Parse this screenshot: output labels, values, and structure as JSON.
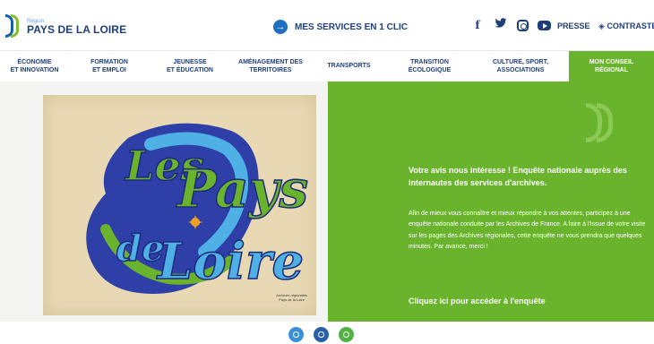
{
  "header": {
    "logo_small": "Région",
    "logo_name": "PAYS DE LA LOIRE",
    "services_label": "MES SERVICES EN 1 CLIC",
    "presse_label": "PRESSE",
    "contraste_label": "CONTRASTE",
    "contraste_icon": "◈",
    "social_icons": [
      "facebook-icon",
      "twitter-icon",
      "instagram-icon",
      "youtube-icon"
    ]
  },
  "nav": {
    "items": [
      {
        "line1": "ÉCONOMIE",
        "line2": "ET INNOVATION"
      },
      {
        "line1": "FORMATION",
        "line2": "ET EMPLOI"
      },
      {
        "line1": "JEUNESSE",
        "line2": "ET ÉDUCATION"
      },
      {
        "line1": "AMÉNAGEMENT DES",
        "line2": "TERRITOIRES"
      },
      {
        "line1": "TRANSPORTS",
        "line2": ""
      },
      {
        "line1": "TRANSITION",
        "line2": "ÉCOLOGIQUE"
      },
      {
        "line1": "CULTURE, SPORT,",
        "line2": "ASSOCIATIONS"
      },
      {
        "line1": "MON CONSEIL",
        "line2": "RÉGIONAL"
      }
    ]
  },
  "poster": {
    "line1": "Les",
    "line2": "Pays",
    "line3": "de",
    "line4": "Loire",
    "stamp_line1": "Archives régionales",
    "stamp_line2": "Pays de la Loire"
  },
  "survey": {
    "title": "Votre avis nous intéresse ! Enquête nationale auprès des internautes des services d'archives.",
    "body": "Afin de mieux vous connaître et mieux répondre à vos attentes, participez à une enquête nationale conduite par les Archives de France. A faire à l'issue de votre visite sur les pages des Archives régionales, cette enquête ne vous prendra que quelques minutes. Par avance, merci !",
    "cta": "Cliquez ici pour accéder à l'enquête"
  },
  "bottom_icons": [
    "user-icon",
    "people-icon",
    "search-icon"
  ],
  "colors": {
    "brand_navy": "#1f3f7a",
    "brand_green": "#6ab42d",
    "brand_blue": "#1e6fc0"
  }
}
